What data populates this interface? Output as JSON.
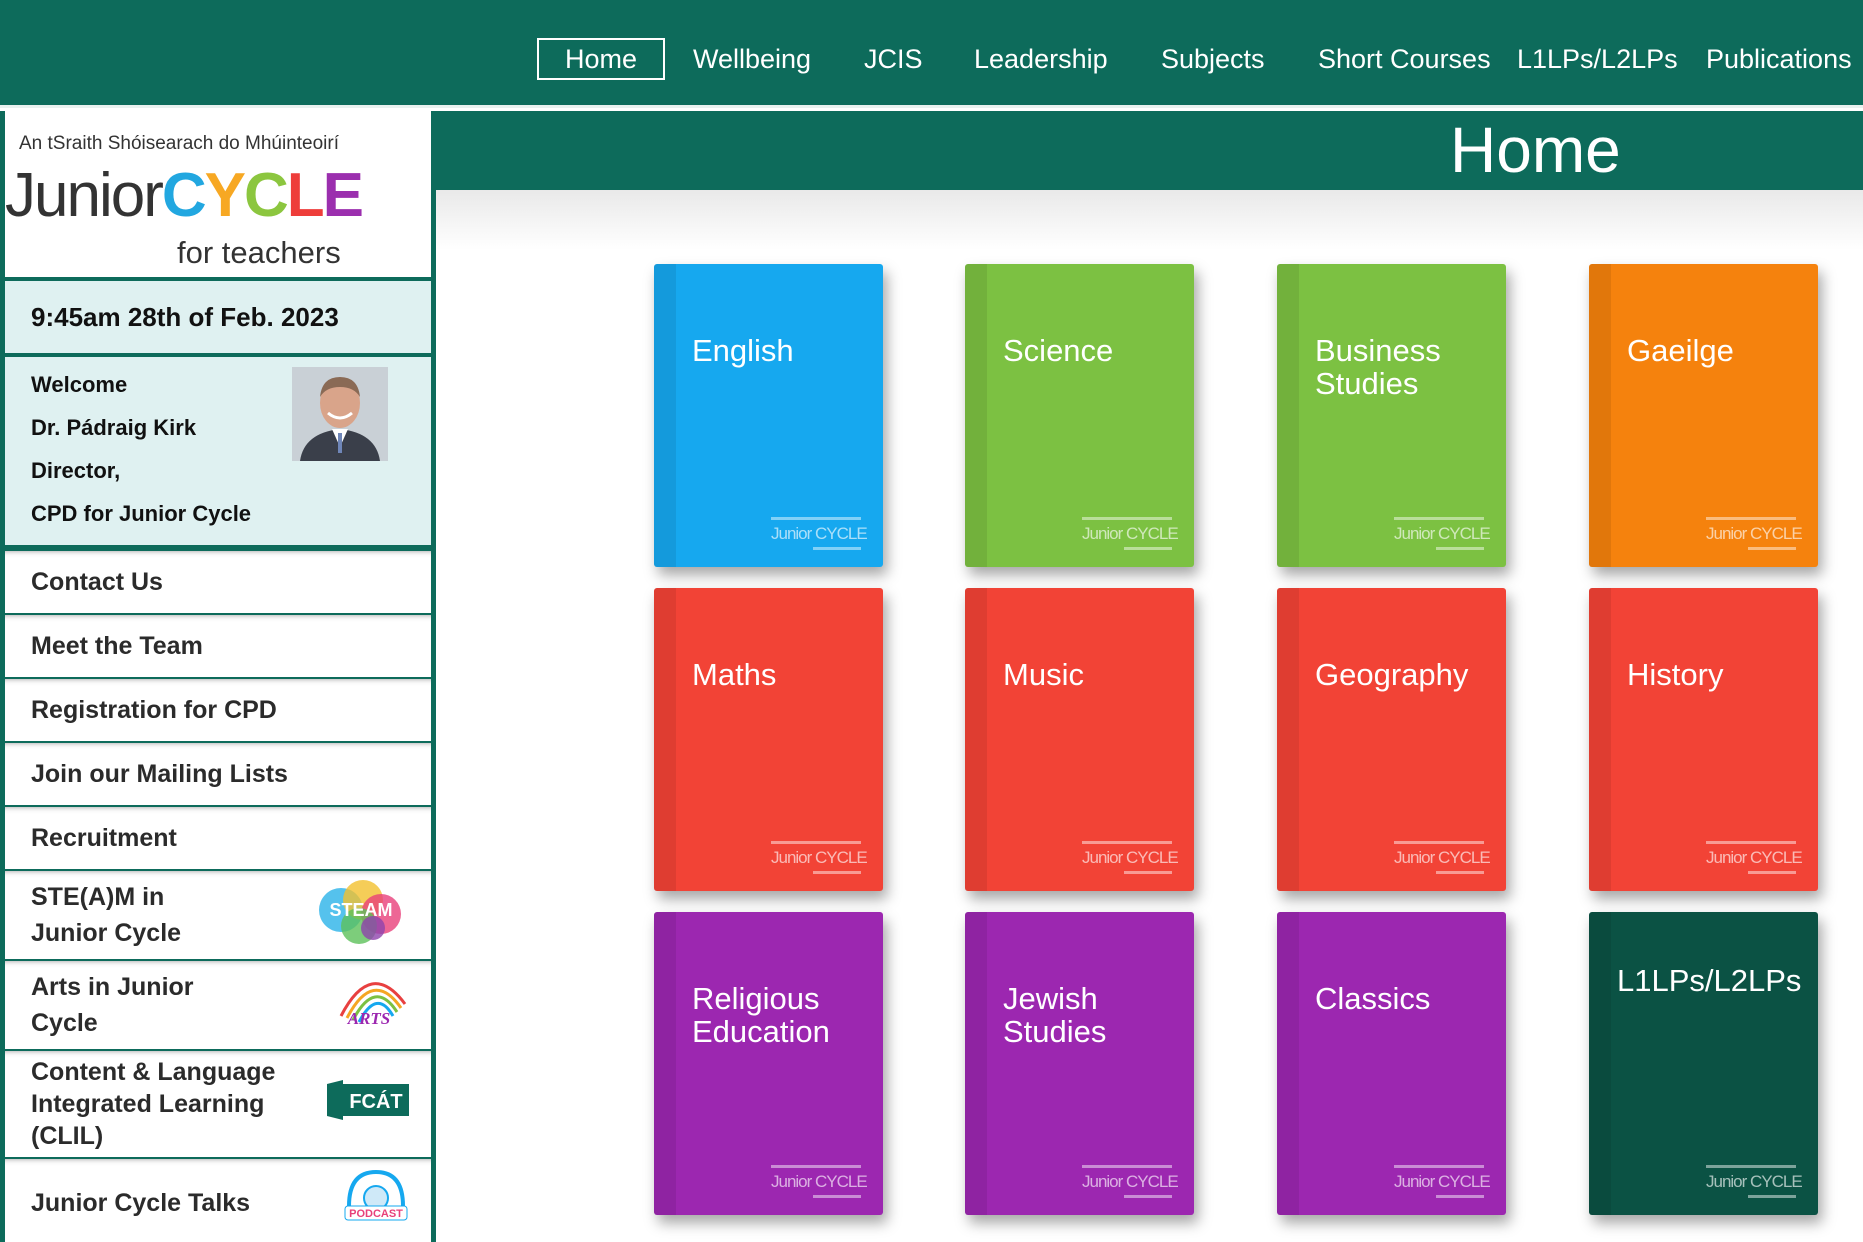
{
  "nav": {
    "items": [
      {
        "label": "Home",
        "active": true
      },
      {
        "label": "Wellbeing"
      },
      {
        "label": "JCIS"
      },
      {
        "label": "Leadership"
      },
      {
        "label": "Subjects"
      },
      {
        "label": "Short Courses"
      },
      {
        "label": "L1LPs/L2LPs"
      },
      {
        "label": "Publications"
      }
    ]
  },
  "logo": {
    "tagline": "An tSraith Shóisearach do Mhúinteoirí",
    "junior": "Junior",
    "cycle_letters": [
      "C",
      "Y",
      "C",
      "L",
      "E"
    ],
    "sub": "for teachers"
  },
  "datetime": "9:45am  28th of Feb. 2023",
  "welcome": {
    "lines": [
      "Welcome",
      "Dr. Pádraig Kirk",
      "Director,",
      "CPD for Junior Cycle"
    ]
  },
  "sidebar_links": [
    {
      "label": "Contact Us"
    },
    {
      "label": "Meet the Team"
    },
    {
      "label": "Registration for CPD"
    },
    {
      "label": "Join our Mailing Lists"
    },
    {
      "label": "Recruitment"
    },
    {
      "label": "STE(A)M in Junior Cycle",
      "badge": "STEAM"
    },
    {
      "label": "Arts in Junior Cycle",
      "badge": "ARTS"
    },
    {
      "label": "Content & Language Integrated Learning (CLIL)",
      "badge": "FCÁT"
    },
    {
      "label": "Junior Cycle Talks",
      "badge": "PODCAST"
    }
  ],
  "main": {
    "title": "Home",
    "tiles": [
      {
        "label": "English",
        "color": "#16a8ef"
      },
      {
        "label": "Science",
        "color": "#7cc142"
      },
      {
        "label": "Business Studies",
        "color": "#7cc142"
      },
      {
        "label": "Gaeilge",
        "color": "#f5820d"
      },
      {
        "label": "Maths",
        "color": "#f24336"
      },
      {
        "label": "Music",
        "color": "#f24336"
      },
      {
        "label": "Geography",
        "color": "#f24336"
      },
      {
        "label": "History",
        "color": "#f24336"
      },
      {
        "label": "Religious Education",
        "color": "#9c27b0"
      },
      {
        "label": "Jewish Studies",
        "color": "#9c27b0"
      },
      {
        "label": "Classics",
        "color": "#9c27b0"
      },
      {
        "label": "L1LPs/L2LPs",
        "color": "#0b5244"
      }
    ],
    "tile_mark": "Junior CYCLE"
  }
}
